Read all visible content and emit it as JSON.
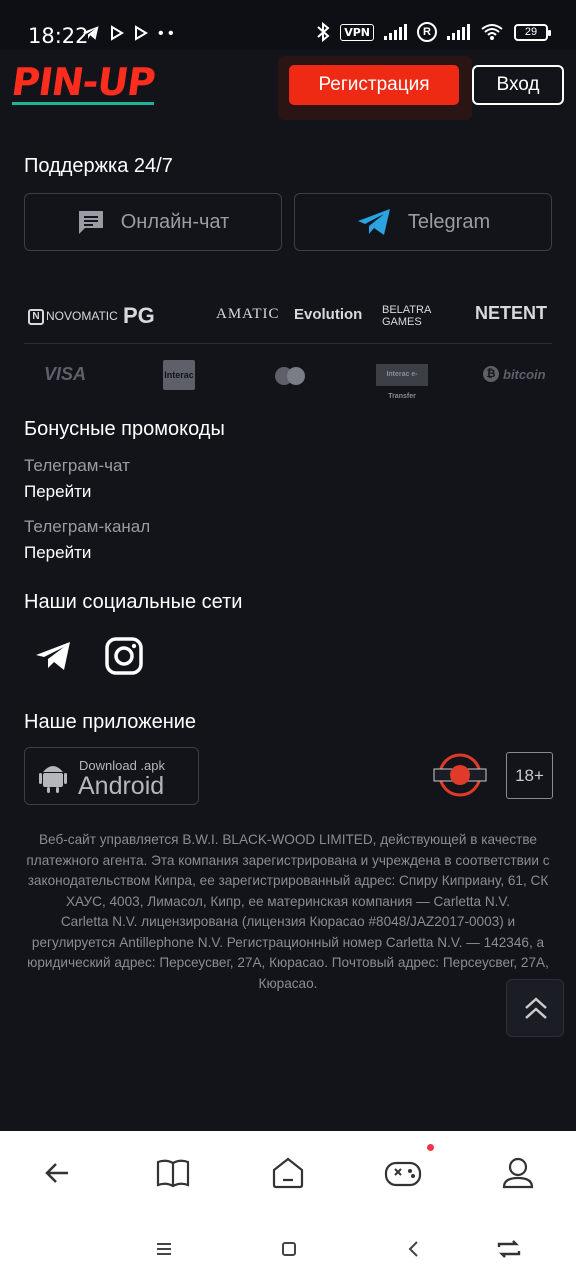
{
  "status_bar": {
    "time": "18:22",
    "vpn": "VPN",
    "battery": "29"
  },
  "header": {
    "logo": "PIN-UP",
    "register_label": "Регистрация",
    "login_label": "Вход"
  },
  "support": {
    "title": "Поддержка 24/7",
    "chat_label": "Онлайн-чат",
    "telegram_label": "Telegram"
  },
  "providers": [
    "NOVOMATIC",
    "PG",
    "AMATIC",
    "Evolution",
    "BELATRA GAMES",
    "NETENT"
  ],
  "payments": [
    "VISA",
    "Interac",
    "mastercard",
    "Interac e-Transfer",
    "bitcoin"
  ],
  "bonus": {
    "title": "Бонусные промокоды",
    "links": [
      {
        "label": "Телеграм-чат",
        "action": "Перейти"
      },
      {
        "label": "Телеграм-канал",
        "action": "Перейти"
      }
    ]
  },
  "social": {
    "title": "Наши социальные сети",
    "icons": [
      "telegram-icon",
      "instagram-icon"
    ]
  },
  "app": {
    "title": "Наше приложение",
    "download_small": "Download .apk",
    "download_big": "Android",
    "age": "18+"
  },
  "legal": {
    "paragraph1": "Веб-сайт управляется B.W.I. BLACK-WOOD LIMITED, действующей в качестве платежного агента. Эта компания зарегистрирована и учреждена в соответствии с законодательством Кипра, ее зарегистрированный адрес: Спиру Киприану, 61, СК ХАУС, 4003, Лимасол, Кипр, ее материнская компания — Carletta N.V.",
    "paragraph2": "Carletta N.V. лицензирована (лицензия Кюрасао #8048/JAZ2017-0003) и регулируется Antillephone N.V. Регистрационный номер Carletta N.V. — 142346, а юридический адрес: Персеусвег, 27А, Кюрасао. Почтовый адрес: Персеусвег, 27А, Кюрасао."
  },
  "bottom_nav": [
    "back-icon",
    "book-icon",
    "home-icon",
    "gamepad-icon",
    "profile-icon"
  ],
  "colors": {
    "background": "#12141a",
    "brand_red": "#ef2a14",
    "telegram_blue": "#2aa3e0",
    "logo_teal": "#1fb39a"
  }
}
